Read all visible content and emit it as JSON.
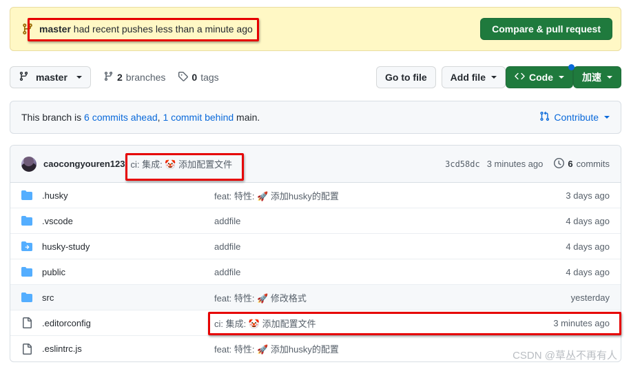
{
  "push_banner": {
    "icon": "branch-icon",
    "branch": "master",
    "message": " had recent pushes less than a minute ago",
    "compare_button": "Compare & pull request",
    "background": "#fff8c5",
    "button_color": "#1f7a3d"
  },
  "toolbar": {
    "branch_selector": "master",
    "branches_count": "2",
    "branches_label": "branches",
    "tags_count": "0",
    "tags_label": "tags",
    "go_to_file": "Go to file",
    "add_file": "Add file",
    "code": "Code",
    "accelerate": "加速",
    "code_badge_color": "#0969da"
  },
  "branch_status": {
    "prefix": "This branch is ",
    "ahead": "6 commits ahead",
    "separator": ", ",
    "behind": "1 commit behind",
    "suffix": " main.",
    "contribute": "Contribute",
    "link_color": "#0969da"
  },
  "commit_header": {
    "author": "caocongyouren123",
    "message": "ci: 集成: 🤡 添加配置文件",
    "sha": "3cd58dc",
    "time": "3 minutes ago",
    "commits_count": "6",
    "commits_label": "commits"
  },
  "files": [
    {
      "icon": "folder-icon",
      "name": ".husky",
      "message": "feat: 特性: 🚀 添加husky的配置",
      "time": "3 days ago",
      "highlight": false
    },
    {
      "icon": "folder-icon",
      "name": ".vscode",
      "message": "addfile",
      "time": "4 days ago",
      "highlight": false
    },
    {
      "icon": "submodule-icon",
      "name": "husky-study",
      "message": "addfile",
      "time": "4 days ago",
      "highlight": false
    },
    {
      "icon": "folder-icon",
      "name": "public",
      "message": "addfile",
      "time": "4 days ago",
      "highlight": false
    },
    {
      "icon": "folder-icon",
      "name": "src",
      "message": "feat: 特性: 🚀 修改格式",
      "time": "yesterday",
      "highlight": true
    },
    {
      "icon": "file-icon",
      "name": ".editorconfig",
      "message": "ci: 集成: 🤡 添加配置文件",
      "time": "3 minutes ago",
      "highlight": false
    },
    {
      "icon": "file-icon",
      "name": ".eslintrc.js",
      "message": "feat: 特性: 🚀 添加husky的配置",
      "time": "",
      "highlight": false
    }
  ],
  "watermark": "CSDN @草丛不再有人",
  "annotation_color": "#e60000"
}
